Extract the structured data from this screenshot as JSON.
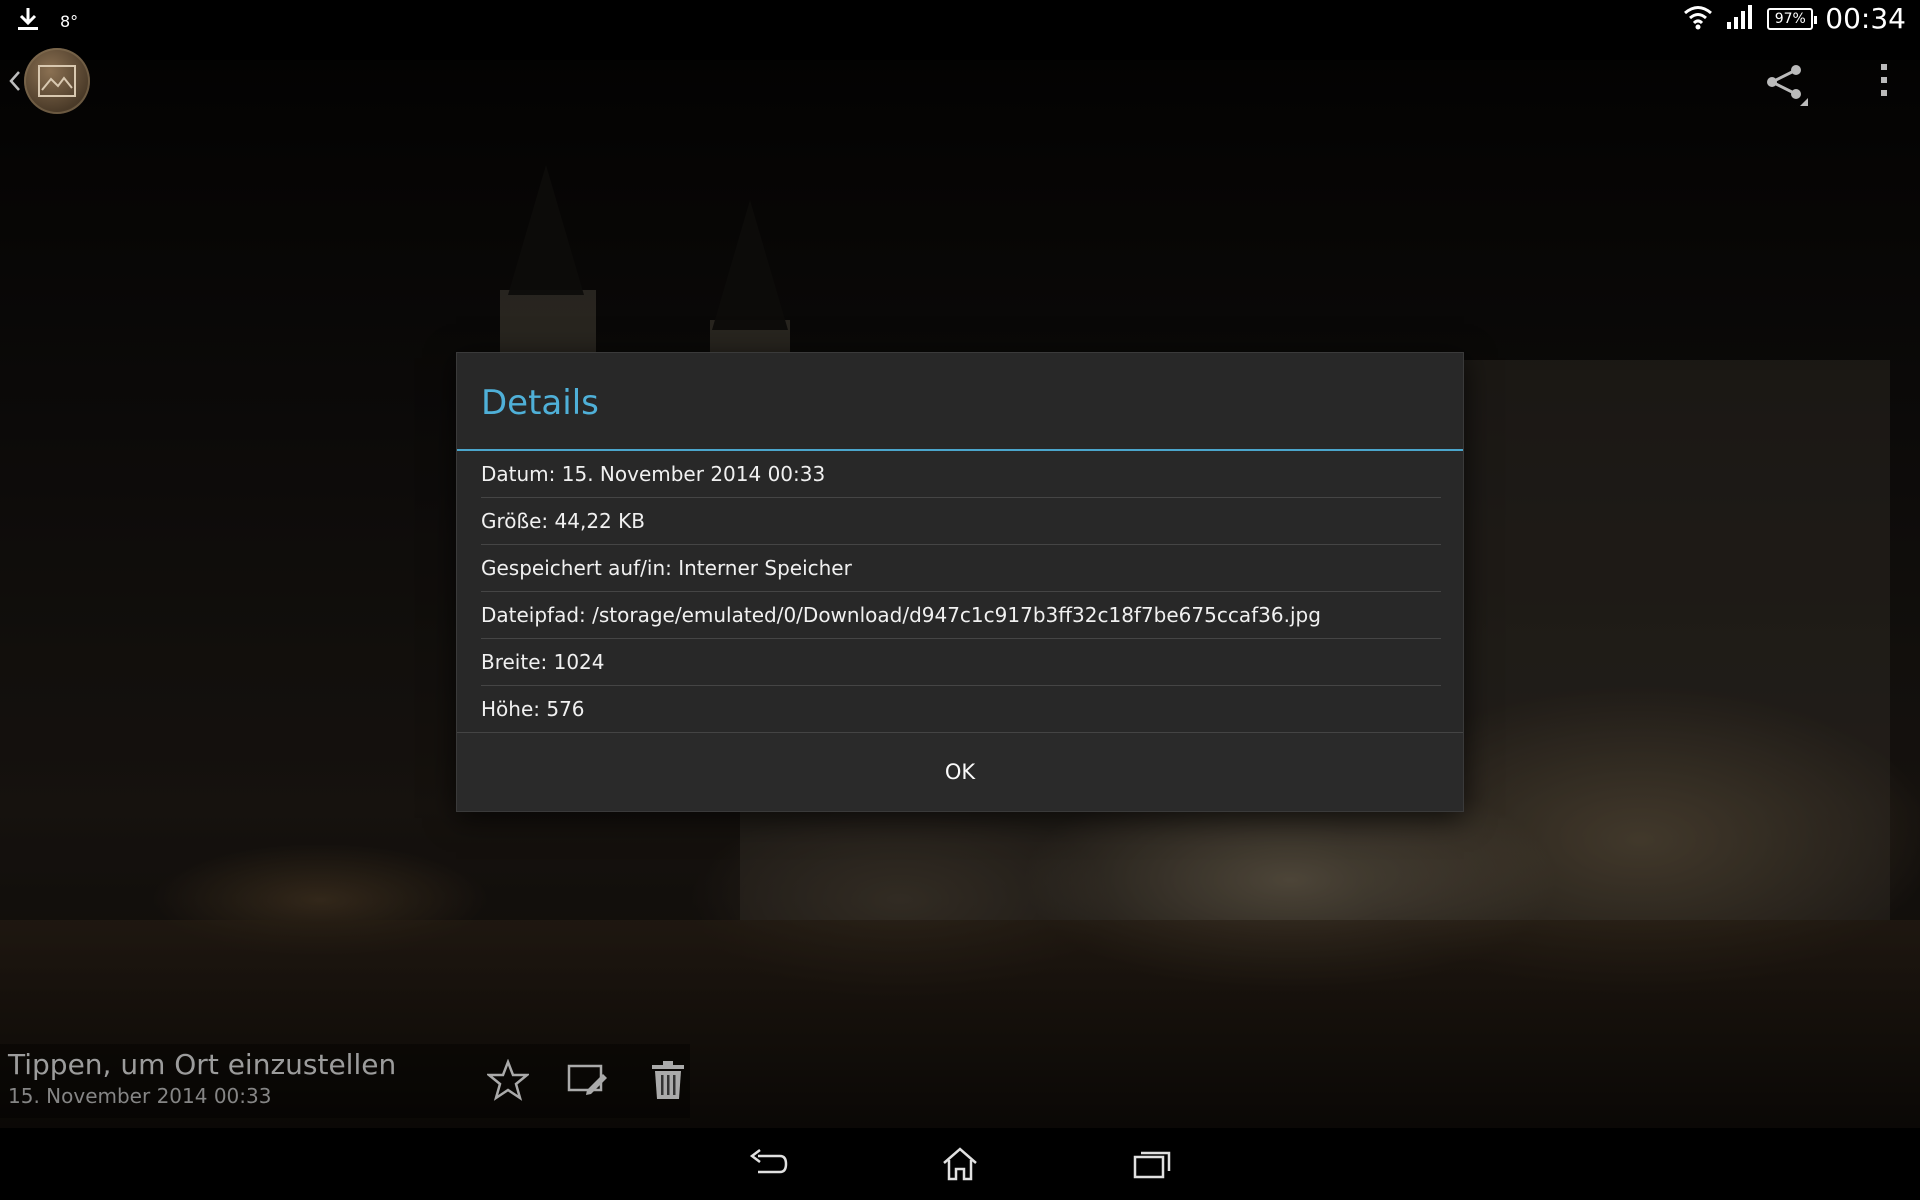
{
  "status_bar": {
    "temperature": "8°",
    "battery": "97%",
    "time": "00:34"
  },
  "action_bar": {
    "app_icon": "gallery-icon",
    "share_icon": "share-icon",
    "overflow_icon": "overflow-menu-icon"
  },
  "photo_info": {
    "location_hint": "Tippen, um Ort einzustellen",
    "date": "15. November 2014 00:33"
  },
  "dialog": {
    "title": "Details",
    "rows": [
      "Datum: 15. November 2014 00:33",
      "Größe: 44,22 KB",
      "Gespeichert auf/in: Interner Speicher",
      "Dateipfad: /storage/emulated/0/Download/d947c1c917b3ff32c18f7be675ccaf36.jpg",
      "Breite: 1024",
      "Höhe: 576"
    ],
    "ok_label": "OK"
  },
  "colors": {
    "accent": "#4fb0d8",
    "dialog_bg": "#282828",
    "divider": "#454545"
  }
}
